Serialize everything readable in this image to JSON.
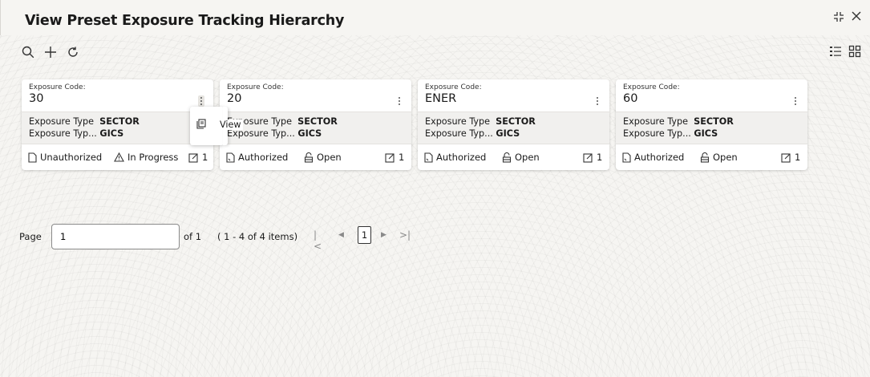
{
  "header": {
    "title": "View Preset Exposure Tracking Hierarchy",
    "minimize_icon": "collapse-icon",
    "close_icon": "close-icon"
  },
  "toolbar": {
    "icons": [
      "search-icon",
      "add-icon",
      "refresh-icon"
    ],
    "view_toggles": [
      "list-view-icon",
      "grid-view-icon"
    ]
  },
  "cards": [
    {
      "code_label": "Exposure Code:",
      "code": "30",
      "type_label": "Exposure Type",
      "type_value": "SECTOR",
      "type2_label": "Exposure Typ...",
      "type2_value": "GICS",
      "auth_status": "Unauthorized",
      "record_status": "In Progress",
      "mod_count": "1"
    },
    {
      "code_label": "Exposure Code:",
      "code": "20",
      "type_label": "Exposure Type",
      "type_value": "SECTOR",
      "type2_label": "Exposure Typ...",
      "type2_value": "GICS",
      "auth_status": "Authorized",
      "record_status": "Open",
      "mod_count": "1"
    },
    {
      "code_label": "Exposure Code:",
      "code": "ENER",
      "type_label": "Exposure Type",
      "type_value": "SECTOR",
      "type2_label": "Exposure Typ...",
      "type2_value": "GICS",
      "auth_status": "Authorized",
      "record_status": "Open",
      "mod_count": "1"
    },
    {
      "code_label": "Exposure Code:",
      "code": "60",
      "type_label": "Exposure Type",
      "type_value": "SECTOR",
      "type2_label": "Exposure Typ...",
      "type2_value": "GICS",
      "auth_status": "Authorized",
      "record_status": "Open",
      "mod_count": "1"
    }
  ],
  "context_menu": {
    "view_label": "View"
  },
  "pagination": {
    "page_label": "Page",
    "page_value": "1",
    "of_label": "of 1",
    "items_label": "( 1 - 4 of 4 items)",
    "current_page": "1"
  }
}
